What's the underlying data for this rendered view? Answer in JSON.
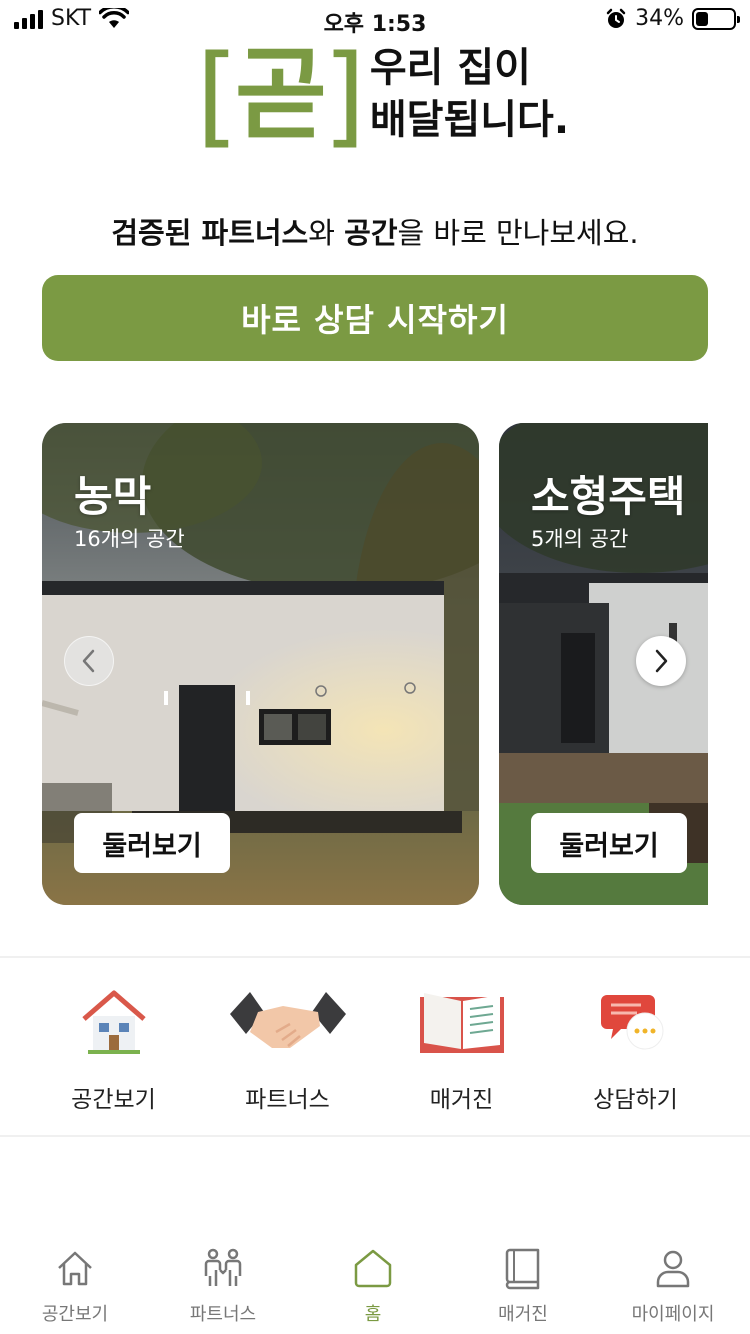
{
  "status_bar": {
    "carrier": "SKT",
    "time": "오후 1:53",
    "battery_pct": "34%",
    "battery_level": 0.34
  },
  "logo": {
    "mark": "곧",
    "line1": "우리 집이",
    "line2": "배달됩니다."
  },
  "tagline": {
    "part1": "검증된 파트너스",
    "part2": "와 ",
    "part3": "공간",
    "part4": "을 바로 만나보세요."
  },
  "cta": {
    "label": "바로 상담 시작하기"
  },
  "colors": {
    "brand": "#7b9a43"
  },
  "carousel": {
    "cards": [
      {
        "title": "농막",
        "subtitle": "16개의 공간",
        "button": "둘러보기"
      },
      {
        "title": "소형주택",
        "subtitle": "5개의 공간",
        "button": "둘러보기"
      }
    ]
  },
  "quick_menu": [
    {
      "label": "공간보기",
      "icon": "house-icon"
    },
    {
      "label": "파트너스",
      "icon": "handshake-icon"
    },
    {
      "label": "매거진",
      "icon": "open-book-icon"
    },
    {
      "label": "상담하기",
      "icon": "chat-bubbles-icon"
    }
  ],
  "tab_bar": [
    {
      "label": "공간보기",
      "icon": "house-outline-icon",
      "active": false
    },
    {
      "label": "파트너스",
      "icon": "people-icon",
      "active": false
    },
    {
      "label": "홈",
      "icon": "home-icon",
      "active": true
    },
    {
      "label": "매거진",
      "icon": "book-icon",
      "active": false
    },
    {
      "label": "마이페이지",
      "icon": "person-icon",
      "active": false
    }
  ]
}
